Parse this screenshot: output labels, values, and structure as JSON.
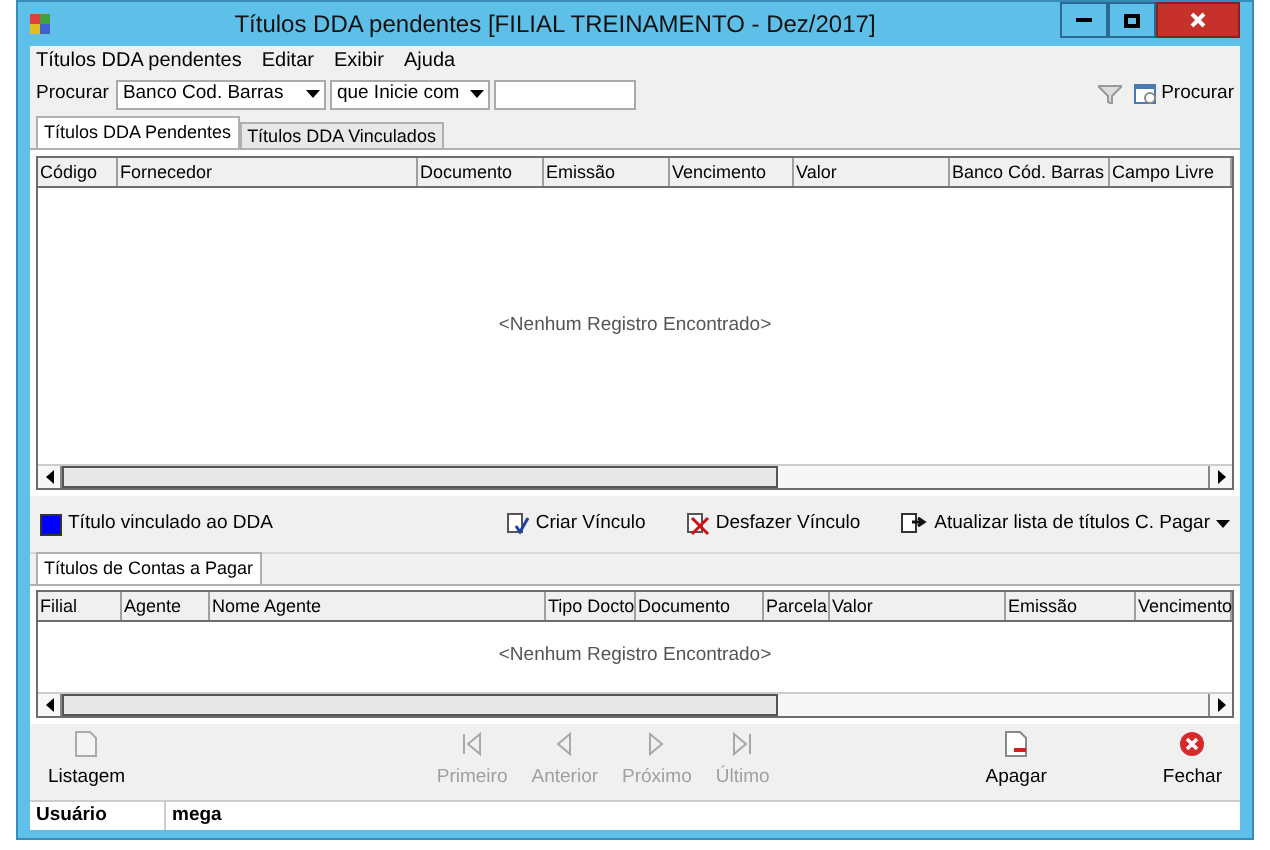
{
  "window": {
    "title": "Títulos DDA pendentes [FILIAL TREINAMENTO - Dez/2017]"
  },
  "menu": [
    "Títulos DDA pendentes",
    "Editar",
    "Exibir",
    "Ajuda"
  ],
  "search": {
    "label": "Procurar",
    "field": "Banco Cod. Barras",
    "mode": "que Inicie com",
    "button": "Procurar"
  },
  "tabs": [
    {
      "label": "Títulos DDA Pendentes",
      "selected": true
    },
    {
      "label": "Títulos DDA Vinculados",
      "selected": false
    }
  ],
  "table": {
    "columns": [
      "Código",
      "Fornecedor",
      "Documento",
      "Emissão",
      "Vencimento",
      "Valor",
      "Banco Cód. Barras",
      "Campo Livre"
    ],
    "empty": "<Nenhum Registro Encontrado>"
  },
  "legend": {
    "label": "Título vinculado ao DDA",
    "color": "#0000ff"
  },
  "actions": [
    {
      "kind": "link",
      "label": "Criar Vínculo"
    },
    {
      "kind": "unlink",
      "label": "Desfazer Vínculo"
    },
    {
      "kind": "refresh",
      "label": "Atualizar lista de títulos C. Pagar"
    }
  ],
  "lower_tabs": [
    {
      "label": "Títulos de Contas a Pagar",
      "selected": true
    }
  ],
  "lower_table": {
    "columns": [
      "Filial",
      "Agente",
      "Nome Agente",
      "Tipo Docto",
      "Documento",
      "Parcela",
      "Valor",
      "Emissão",
      "Vencimento"
    ],
    "empty": "<Nenhum Registro Encontrado>"
  },
  "toolbar": [
    {
      "kind": "list",
      "label": "Listagem",
      "disabled": false
    },
    {
      "kind": "first",
      "label": "Primeiro",
      "disabled": true
    },
    {
      "kind": "prev",
      "label": "Anterior",
      "disabled": true
    },
    {
      "kind": "next",
      "label": "Próximo",
      "disabled": true
    },
    {
      "kind": "last",
      "label": "Último",
      "disabled": true
    },
    {
      "kind": "delete",
      "label": "Apagar",
      "disabled": false
    },
    {
      "kind": "close",
      "label": "Fechar",
      "disabled": false
    }
  ],
  "status_bar": {
    "label": "Usuário",
    "value": "mega"
  }
}
